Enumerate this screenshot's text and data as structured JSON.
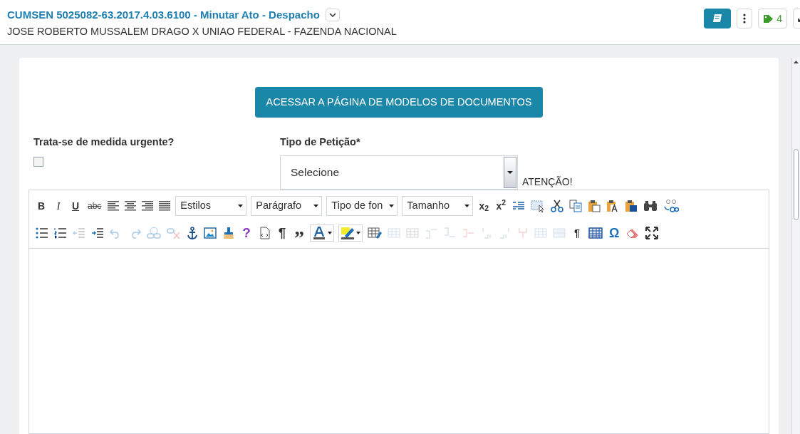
{
  "header": {
    "process": "CUMSEN 5025082-63.2017.4.03.6100",
    "task": " - Minutar Ato - Despacho",
    "parties": "JOSE ROBERTO MUSSALEM DRAGO X UNIAO FEDERAL - FAZENDA NACIONAL",
    "tag_count": "4"
  },
  "form": {
    "button": "ACESSAR A PÁGINA DE MODELOS DE DOCUMENTOS",
    "urgent": {
      "label": "Trata-se de medida urgente?",
      "checked": false
    },
    "petition": {
      "label": "Tipo de Petição*",
      "value": "Selecione",
      "note": "ATENÇÃO!"
    }
  },
  "toolbar": {
    "upper_buttons": [
      {
        "kind": "glyph",
        "text": "B"
      },
      {
        "kind": "glyph",
        "text": "I"
      },
      {
        "kind": "glyph",
        "text": "U"
      },
      {
        "kind": "glyph",
        "text": "abc"
      },
      {
        "kind": "icon",
        "disabled": false
      },
      {
        "kind": "icon",
        "disabled": false
      },
      {
        "kind": "icon",
        "disabled": false
      },
      {
        "kind": "icon",
        "disabled": false
      },
      {
        "kind": "dropdown",
        "text": "Estilos"
      },
      {
        "kind": "dropdown",
        "text": "Parágrafo"
      },
      {
        "kind": "dropdown",
        "text": "Tipo de fon"
      },
      {
        "kind": "dropdown",
        "text": "Tamanho"
      },
      {
        "kind": "glyph",
        "text": "x$_{2}$"
      },
      {
        "kind": "glyph",
        "text": "x$^{2}$"
      },
      {
        "kind": "icon",
        "disabled": false
      },
      {
        "kind": "icon",
        "disabled": false
      },
      {
        "kind": "icon",
        "disabled": false
      },
      {
        "kind": "icon",
        "disabled": false
      },
      {
        "kind": "icon",
        "disabled": false
      },
      {
        "kind": "icon",
        "disabled": false
      },
      {
        "kind": "icon",
        "disabled": false
      },
      {
        "kind": "icon",
        "disabled": false
      },
      {
        "kind": "icon",
        "disabled": false
      }
    ],
    "lower_buttons": [
      {
        "kind": "icon",
        "disabled": false
      },
      {
        "kind": "icon",
        "disabled": false
      },
      {
        "kind": "icon",
        "disabled": true
      },
      {
        "kind": "icon",
        "disabled": false
      },
      {
        "kind": "icon",
        "disabled": true
      },
      {
        "kind": "icon",
        "disabled": true
      },
      {
        "kind": "icon",
        "disabled": true
      },
      {
        "kind": "icon",
        "disabled": true
      },
      {
        "kind": "icon",
        "disabled": false
      },
      {
        "kind": "icon",
        "disabled": false
      },
      {
        "kind": "icon",
        "disabled": false
      },
      {
        "kind": "glyph",
        "text": "?"
      },
      {
        "kind": "icon",
        "disabled": false
      },
      {
        "kind": "glyph",
        "text": "¶"
      },
      {
        "kind": "glyph",
        "text": "”"
      },
      {
        "kind": "split",
        "disabled": false
      },
      {
        "kind": "split",
        "disabled": false
      },
      {
        "kind": "icon",
        "disabled": false
      },
      {
        "kind": "icon",
        "disabled": true
      },
      {
        "kind": "icon",
        "disabled": true
      },
      {
        "kind": "icon",
        "disabled": true
      },
      {
        "kind": "icon",
        "disabled": true
      },
      {
        "kind": "icon",
        "disabled": true
      },
      {
        "kind": "icon",
        "disabled": true
      },
      {
        "kind": "icon",
        "disabled": true
      },
      {
        "kind": "icon",
        "disabled": true
      },
      {
        "kind": "icon",
        "disabled": true
      },
      {
        "kind": "icon",
        "disabled": true
      },
      {
        "kind": "glyph",
        "text": "¶"
      },
      {
        "kind": "icon",
        "disabled": false
      },
      {
        "kind": "glyph",
        "text": "Ω"
      },
      {
        "kind": "icon",
        "disabled": false
      },
      {
        "kind": "icon",
        "disabled": false
      }
    ]
  }
}
